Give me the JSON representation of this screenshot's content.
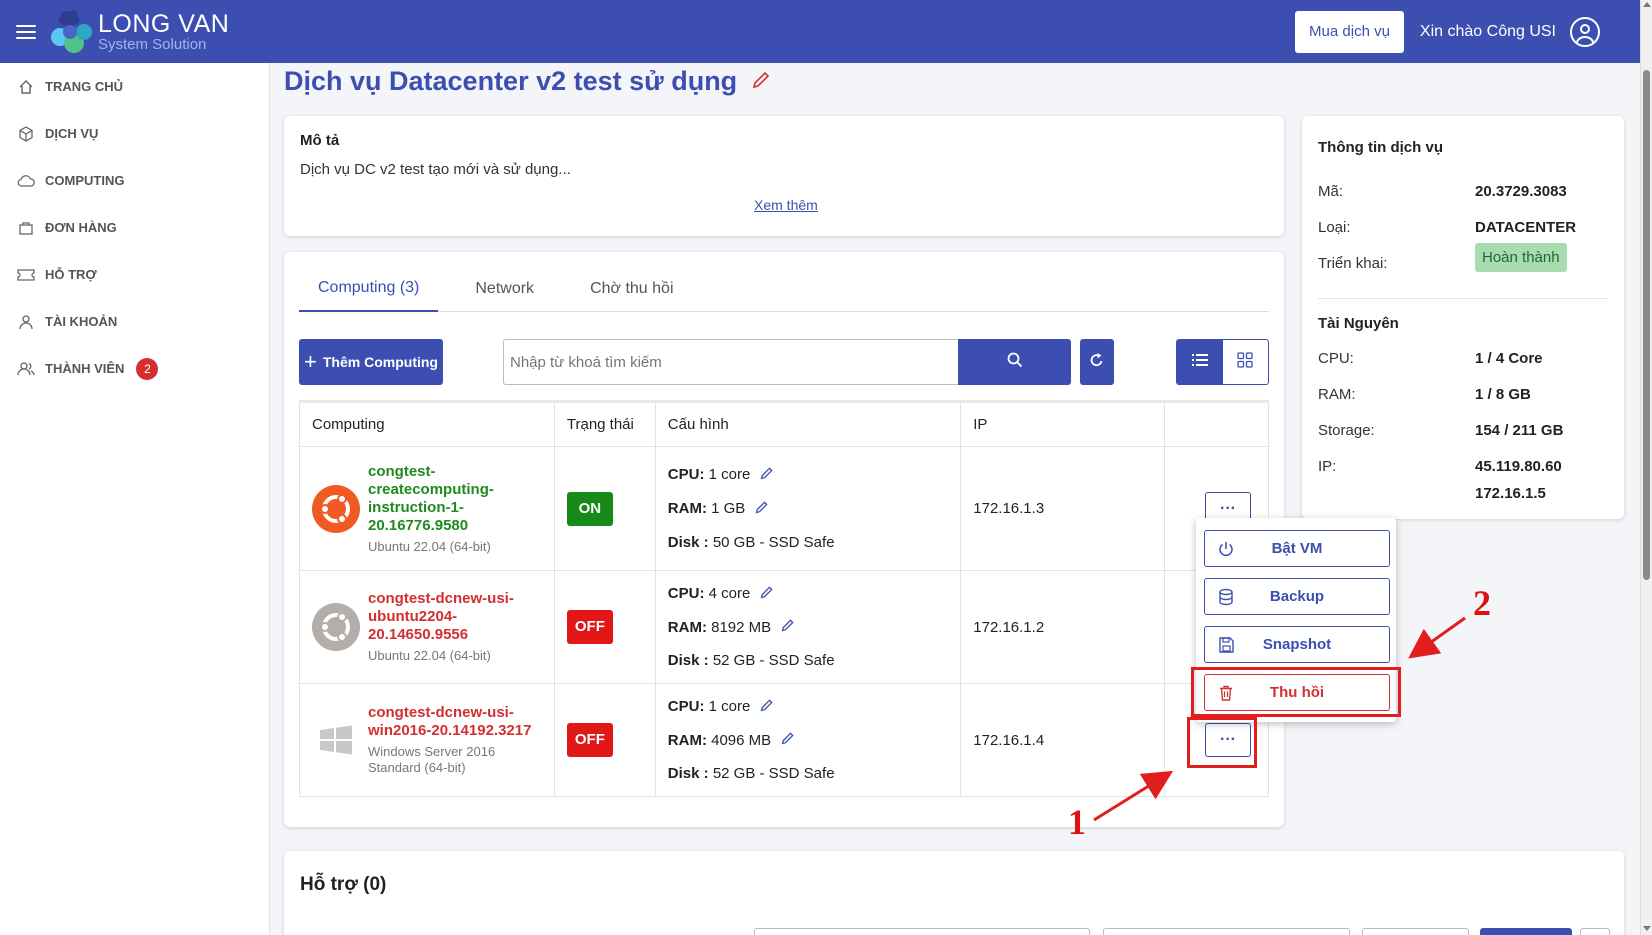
{
  "header": {
    "logo_line1": "LONG VAN",
    "logo_line2": "System Solution",
    "buy_button": "Mua dịch vụ",
    "greeting": "Xin chào Công USI"
  },
  "sidebar": {
    "items": [
      {
        "label": "TRANG CHỦ",
        "icon": "home-icon"
      },
      {
        "label": "DỊCH VỤ",
        "icon": "cube-icon"
      },
      {
        "label": "COMPUTING",
        "icon": "cloud-icon"
      },
      {
        "label": "ĐƠN HÀNG",
        "icon": "bag-icon"
      },
      {
        "label": "HỖ TRỢ",
        "icon": "ticket-icon"
      },
      {
        "label": "TÀI KHOẢN",
        "icon": "user-icon"
      },
      {
        "label": "THÀNH VIÊN",
        "icon": "users-icon",
        "badge": "2"
      }
    ]
  },
  "page": {
    "title": "Dịch vụ Datacenter v2 test sử dụng"
  },
  "description": {
    "heading": "Mô tả",
    "text": "Dịch vụ DC v2 test tạo mới và sử dụng...",
    "more_link": "Xem thêm"
  },
  "tabs": [
    "Computing (3)",
    "Network",
    "Chờ thu hồi"
  ],
  "toolbar": {
    "add_label": "Thêm Computing",
    "search_placeholder": "Nhập từ khoá tìm kiếm"
  },
  "table": {
    "headers": [
      "Computing",
      "Trạng thái",
      "Cấu hình",
      "IP",
      ""
    ],
    "rows": [
      {
        "name": "congtest-createcomputing-instruction-1-20.16776.9580",
        "name_lines": [
          "congtest-",
          "createcomputing-",
          "instruction-1-",
          "20.16776.9580"
        ],
        "os": "Ubuntu 22.04 (64-bit)",
        "os_lines": [
          "Ubuntu 22.04 (64-bit)"
        ],
        "status": "ON",
        "cpu": "1 core",
        "ram": "1 GB",
        "disk": "50 GB - SSD Safe",
        "ip": "172.16.1.3"
      },
      {
        "name": "congtest-dcnew-usi-ubuntu2204-20.14650.9556",
        "name_lines": [
          "congtest-dcnew-usi-",
          "ubuntu2204-",
          "20.14650.9556"
        ],
        "os": "Ubuntu 22.04 (64-bit)",
        "os_lines": [
          "Ubuntu 22.04 (64-bit)"
        ],
        "status": "OFF",
        "cpu": "4 core",
        "ram": "8192 MB",
        "disk": "52 GB - SSD Safe",
        "ip": "172.16.1.2"
      },
      {
        "name": "congtest-dcnew-usi-win2016-20.14192.3217",
        "name_lines": [
          "congtest-dcnew-usi-",
          "win2016-20.14192.3217"
        ],
        "os": "Windows Server 2016 Standard (64-bit)",
        "os_lines": [
          "Windows Server 2016",
          "Standard (64-bit)"
        ],
        "status": "OFF",
        "cpu": "1 core",
        "ram": "4096 MB",
        "disk": "52 GB - SSD Safe",
        "ip": "172.16.1.4"
      }
    ],
    "labels": {
      "cpu": "CPU:",
      "ram": "RAM:",
      "disk": "Disk :"
    },
    "more_button": "···"
  },
  "menu": {
    "items": [
      "Bật VM",
      "Backup",
      "Snapshot",
      "Thu hồi"
    ]
  },
  "service_info": {
    "heading": "Thông tin dịch vụ",
    "code_label": "Mã:",
    "code": "20.3729.3083",
    "type_label": "Loại:",
    "type": "DATACENTER",
    "deploy_label": "Triển khai:",
    "deploy": "Hoàn thành"
  },
  "resources": {
    "heading": "Tài Nguyên",
    "cpu_label": "CPU:",
    "cpu": "1 / 4 Core",
    "ram_label": "RAM:",
    "ram": "1 / 8 GB",
    "storage_label": "Storage:",
    "storage": "154 / 211 GB",
    "ip_label": "IP:",
    "ip1": "45.119.80.60",
    "ip2": "172.16.1.5"
  },
  "annotations": {
    "one": "1",
    "two": "2"
  },
  "support": {
    "heading": "Hỗ trợ (0)"
  },
  "colors": {
    "primary": "#3c4fb0",
    "on": "#188a18",
    "off": "#e21717",
    "annotation": "#e21d1d"
  }
}
